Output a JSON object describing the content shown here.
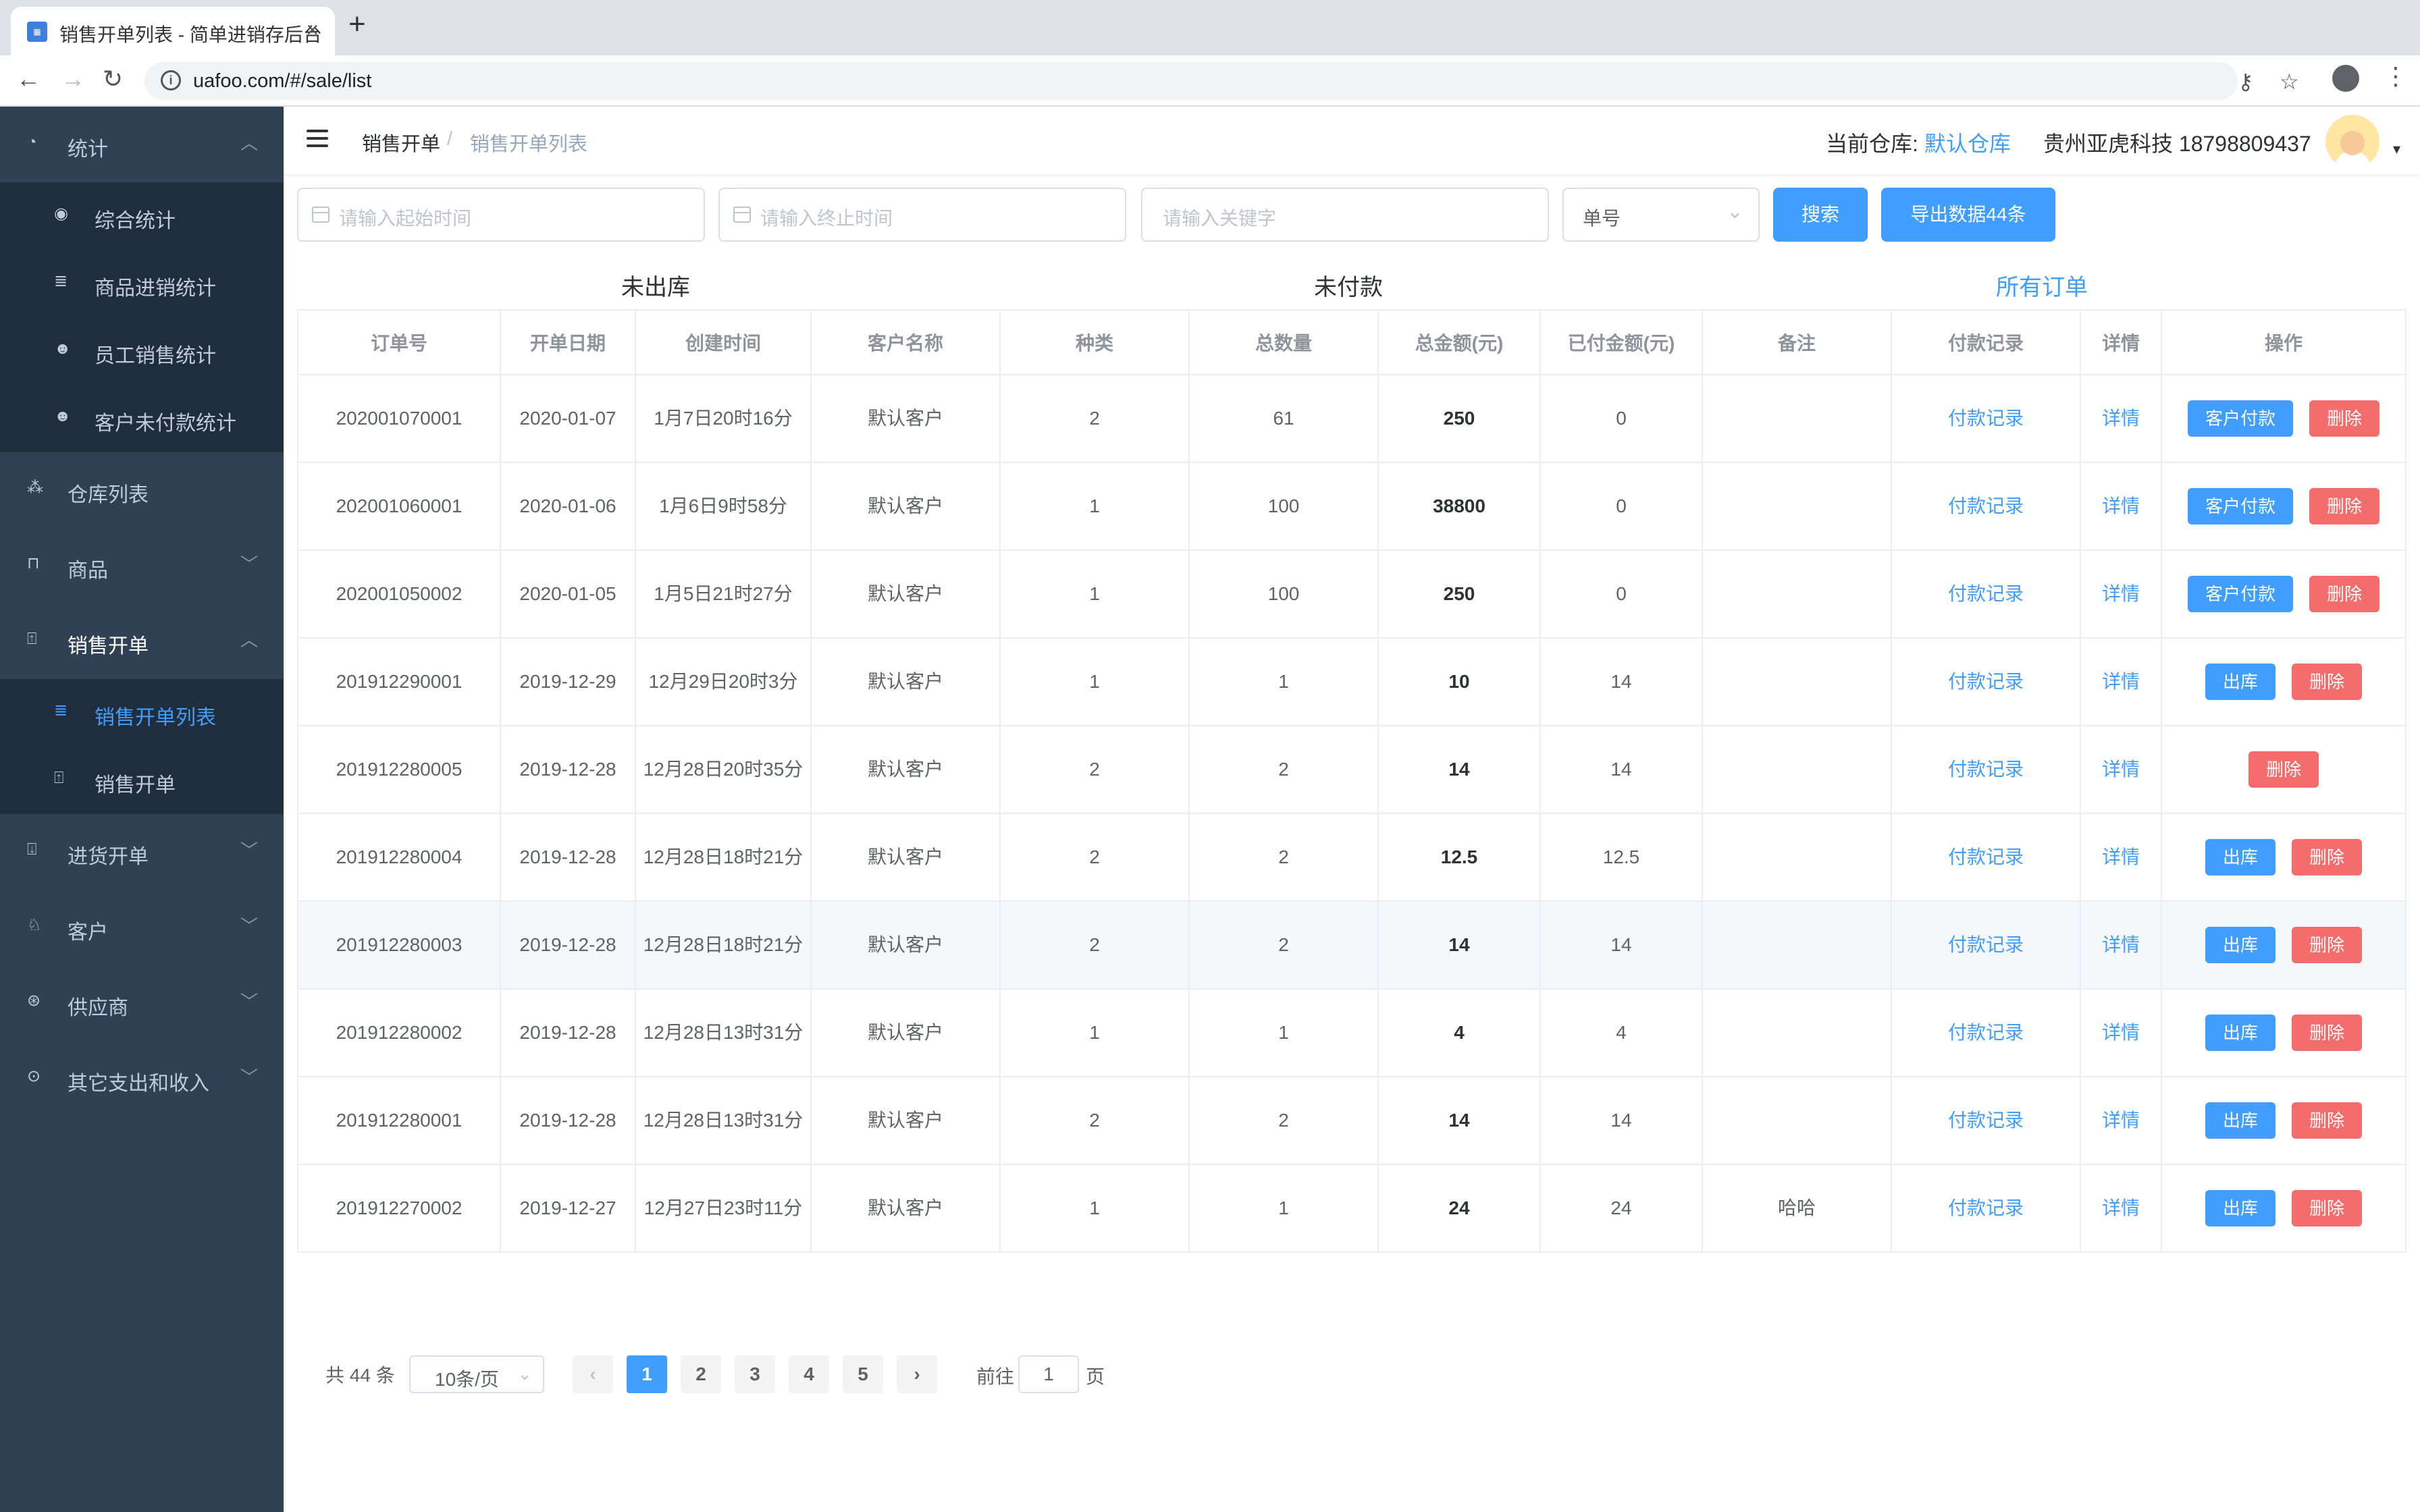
{
  "browser": {
    "tab_title": "销售开单列表 - 简单进销存后台",
    "url": "uafoo.com/#/sale/list"
  },
  "sidebar": {
    "items": [
      {
        "label": "统计",
        "icon": "pie-chart-icon"
      },
      {
        "label": "综合统计",
        "icon": "dashboard-icon"
      },
      {
        "label": "商品进销统计",
        "icon": "search-list-icon"
      },
      {
        "label": "员工销售统计",
        "icon": "user-group-icon"
      },
      {
        "label": "客户未付款统计",
        "icon": "user-group-icon"
      },
      {
        "label": "仓库列表",
        "icon": "warehouse-icon"
      },
      {
        "label": "商品",
        "icon": "bag-icon"
      },
      {
        "label": "销售开单",
        "icon": "upload-icon"
      },
      {
        "label": "销售开单列表",
        "icon": "search-list-icon"
      },
      {
        "label": "销售开单",
        "icon": "upload-icon"
      },
      {
        "label": "进货开单",
        "icon": "download-icon"
      },
      {
        "label": "客户",
        "icon": "users-icon"
      },
      {
        "label": "供应商",
        "icon": "supplier-icon"
      },
      {
        "label": "其它支出和收入",
        "icon": "money-icon"
      }
    ]
  },
  "header": {
    "breadcrumb_1": "销售开单",
    "breadcrumb_sep": "/",
    "breadcrumb_2": "销售开单列表",
    "warehouse_label": "当前仓库:",
    "warehouse_value": "默认仓库",
    "company": "贵州亚虎科技 18798809437"
  },
  "filters": {
    "start_placeholder": "请输入起始时间",
    "end_placeholder": "请输入终止时间",
    "keyword_placeholder": "请输入关键字",
    "field_select": "单号",
    "search_label": "搜索",
    "export_label": "导出数据44条"
  },
  "status_tabs": {
    "not_shipped": "未出库",
    "unpaid": "未付款",
    "all": "所有订单"
  },
  "table": {
    "headers": [
      "订单号",
      "开单日期",
      "创建时间",
      "客户名称",
      "种类",
      "总数量",
      "总金额(元)",
      "已付金额(元)",
      "备注",
      "付款记录",
      "详情",
      "操作"
    ],
    "rows": [
      {
        "id": "202001070001",
        "date": "2020-01-07",
        "created": "1月7日20时16分",
        "customer": "默认客户",
        "kinds": "2",
        "qty": "61",
        "total": "250",
        "paid": "0",
        "note": "",
        "pay_link": "付款记录",
        "detail": "详情",
        "btn1": "客户付款",
        "btn2": "删除"
      },
      {
        "id": "202001060001",
        "date": "2020-01-06",
        "created": "1月6日9时58分",
        "customer": "默认客户",
        "kinds": "1",
        "qty": "100",
        "total": "38800",
        "paid": "0",
        "note": "",
        "pay_link": "付款记录",
        "detail": "详情",
        "btn1": "客户付款",
        "btn2": "删除"
      },
      {
        "id": "202001050002",
        "date": "2020-01-05",
        "created": "1月5日21时27分",
        "customer": "默认客户",
        "kinds": "1",
        "qty": "100",
        "total": "250",
        "paid": "0",
        "note": "",
        "pay_link": "付款记录",
        "detail": "详情",
        "btn1": "客户付款",
        "btn2": "删除"
      },
      {
        "id": "201912290001",
        "date": "2019-12-29",
        "created": "12月29日20时3分",
        "customer": "默认客户",
        "kinds": "1",
        "qty": "1",
        "total": "10",
        "paid": "14",
        "note": "",
        "pay_link": "付款记录",
        "detail": "详情",
        "btn1": "出库",
        "btn2": "删除"
      },
      {
        "id": "201912280005",
        "date": "2019-12-28",
        "created": "12月28日20时35分",
        "customer": "默认客户",
        "kinds": "2",
        "qty": "2",
        "total": "14",
        "paid": "14",
        "note": "",
        "pay_link": "付款记录",
        "detail": "详情",
        "btn1": "",
        "btn2": "删除"
      },
      {
        "id": "201912280004",
        "date": "2019-12-28",
        "created": "12月28日18时21分",
        "customer": "默认客户",
        "kinds": "2",
        "qty": "2",
        "total": "12.5",
        "paid": "12.5",
        "note": "",
        "pay_link": "付款记录",
        "detail": "详情",
        "btn1": "出库",
        "btn2": "删除"
      },
      {
        "id": "201912280003",
        "date": "2019-12-28",
        "created": "12月28日18时21分",
        "customer": "默认客户",
        "kinds": "2",
        "qty": "2",
        "total": "14",
        "paid": "14",
        "note": "",
        "pay_link": "付款记录",
        "detail": "详情",
        "btn1": "出库",
        "btn2": "删除"
      },
      {
        "id": "201912280002",
        "date": "2019-12-28",
        "created": "12月28日13时31分",
        "customer": "默认客户",
        "kinds": "1",
        "qty": "1",
        "total": "4",
        "paid": "4",
        "note": "",
        "pay_link": "付款记录",
        "detail": "详情",
        "btn1": "出库",
        "btn2": "删除"
      },
      {
        "id": "201912280001",
        "date": "2019-12-28",
        "created": "12月28日13时31分",
        "customer": "默认客户",
        "kinds": "2",
        "qty": "2",
        "total": "14",
        "paid": "14",
        "note": "",
        "pay_link": "付款记录",
        "detail": "详情",
        "btn1": "出库",
        "btn2": "删除"
      },
      {
        "id": "201912270002",
        "date": "2019-12-27",
        "created": "12月27日23时11分",
        "customer": "默认客户",
        "kinds": "1",
        "qty": "1",
        "total": "24",
        "paid": "24",
        "note": "哈哈",
        "pay_link": "付款记录",
        "detail": "详情",
        "btn1": "出库",
        "btn2": "删除"
      }
    ]
  },
  "pagination": {
    "total_text": "共 44 条",
    "page_size": "10条/页",
    "pages": [
      "1",
      "2",
      "3",
      "4",
      "5"
    ],
    "goto_label": "前往",
    "goto_value": "1",
    "page_suffix": "页"
  },
  "colors": {
    "primary": "#409eff",
    "danger": "#f56c6c",
    "sidebar": "#304156",
    "sidebar_sub": "#1f2d3d"
  }
}
